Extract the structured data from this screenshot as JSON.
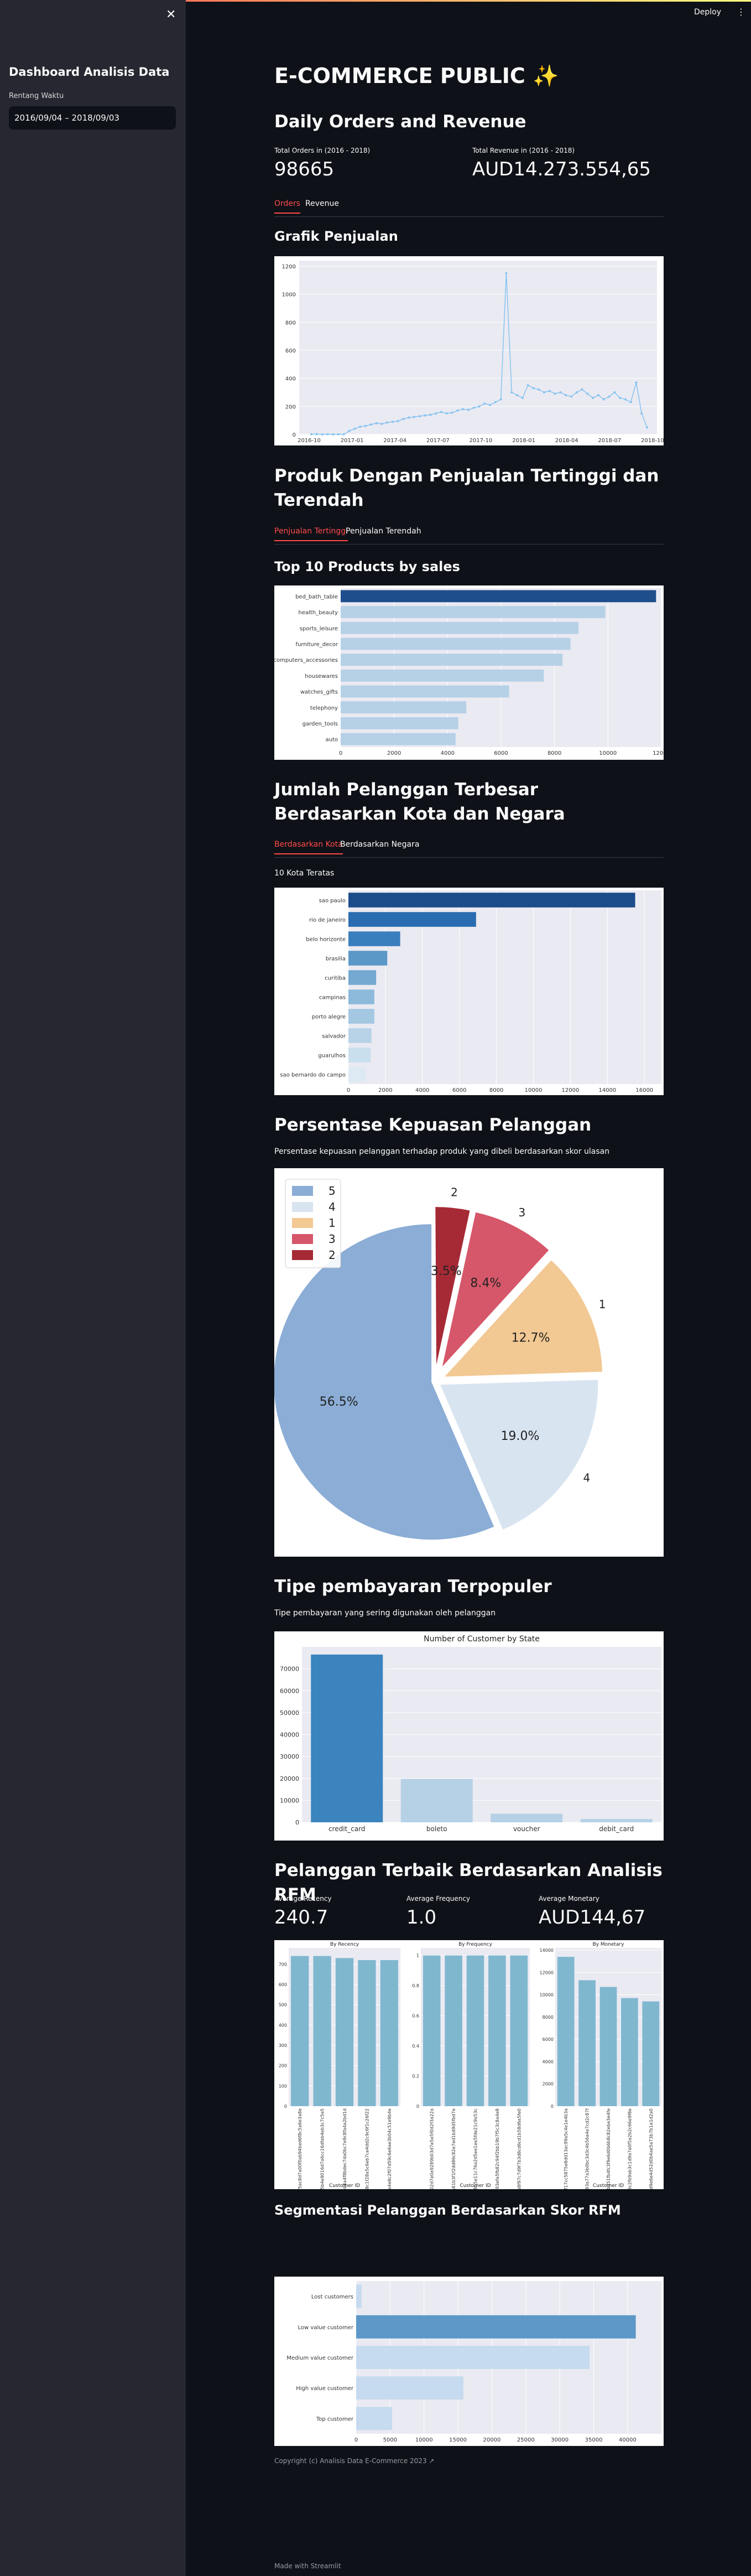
{
  "app": {
    "deploy_label": "Deploy",
    "more_icon": "vertical-dots-icon",
    "close_icon": "close-icon",
    "made_with": "Made with Streamlit"
  },
  "sidebar": {
    "title": "Dashboard Analisis Data",
    "date_label": "Rentang Waktu",
    "date_value": "2016/09/04 – 2018/09/03"
  },
  "header": {
    "title": "E-COMMERCE PUBLIC ✨"
  },
  "orders": {
    "title": "Daily Orders and Revenue",
    "total_orders_label": "Total Orders in (2016 - 2018)",
    "total_orders_value": "98665",
    "total_revenue_label": "Total Revenue in (2016 - 2018)",
    "total_revenue_value": "AUD14.273.554,65",
    "tabs": [
      "Orders",
      "Revenue"
    ],
    "chart_title": "Grafik Penjualan"
  },
  "products": {
    "title": "Produk Dengan Penjualan Tertinggi dan Terendah",
    "tabs": [
      "Penjualan Tertinggi",
      "Penjualan Terendah"
    ],
    "subtitle": "Top 10 Products by sales"
  },
  "customers": {
    "title": "Jumlah Pelanggan Terbesar Berdasarkan Kota dan Negara",
    "tabs": [
      "Berdasarkan Kota",
      "Berdasarkan Negara"
    ],
    "subtitle": "10 Kota Teratas"
  },
  "satisfaction": {
    "title": "Persentase Kepuasan Pelanggan",
    "caption": "Persentase kepuasan pelanggan terhadap produk yang dibeli berdasarkan skor ulasan"
  },
  "payment": {
    "title": "Tipe pembayaran Terpopuler",
    "caption": "Tipe pembayaran yang sering digunakan oleh pelanggan"
  },
  "rfm": {
    "title": "Pelanggan Terbaik Berdasarkan Analisis RFM",
    "recency_label": "Average Recency",
    "recency_value": "240.7",
    "frequency_label": "Average Frequency",
    "frequency_value": "1.0",
    "monetary_label": "Average Monetary",
    "monetary_value": "AUD144,67"
  },
  "segment": {
    "title": "Segmentasi Pelanggan Berdasarkan Skor RFM"
  },
  "footer": {
    "copyright": "Copyright (c) Analisis Data E-Commerce 2023 ↗"
  },
  "chart_data": [
    {
      "type": "line",
      "title": "",
      "xlabel": "",
      "ylabel": "",
      "x_ticks": [
        "2016-10",
        "2017-01",
        "2017-04",
        "2017-07",
        "2017-10",
        "2018-01",
        "2018-04",
        "2018-07",
        "2018-10"
      ],
      "y_ticks": [
        0,
        200,
        400,
        600,
        800,
        1000,
        1200
      ],
      "ylim": [
        0,
        1200
      ],
      "series": [
        {
          "values": [
            1,
            2,
            0,
            1,
            0,
            1,
            0,
            25,
            40,
            55,
            60,
            70,
            80,
            75,
            85,
            90,
            95,
            110,
            120,
            125,
            130,
            135,
            140,
            150,
            160,
            150,
            155,
            170,
            180,
            175,
            190,
            200,
            220,
            210,
            230,
            250,
            1150,
            300,
            280,
            260,
            350,
            330,
            320,
            300,
            310,
            290,
            300,
            280,
            270,
            300,
            320,
            290,
            260,
            280,
            250,
            270,
            300,
            260,
            250,
            230,
            370,
            150,
            50
          ]
        }
      ],
      "color": "#87c4f0"
    },
    {
      "type": "bar",
      "orientation": "horizontal",
      "title": "",
      "categories": [
        "bed_bath_table",
        "health_beauty",
        "sports_leisure",
        "furniture_decor",
        "computers_accessories",
        "housewares",
        "watches_gifts",
        "telephony",
        "garden_tools",
        "auto"
      ],
      "values": [
        11800,
        9900,
        8900,
        8600,
        8300,
        7600,
        6300,
        4700,
        4400,
        4300
      ],
      "xlim": [
        0,
        12000
      ],
      "x_ticks": [
        0,
        2000,
        4000,
        6000,
        8000,
        10000,
        12000
      ],
      "colors": [
        "#1f4e8c",
        "#b6d1e6",
        "#b6d1e6",
        "#b6d1e6",
        "#b6d1e6",
        "#b6d1e6",
        "#b6d1e6",
        "#b6d1e6",
        "#b6d1e6",
        "#b6d1e6"
      ]
    },
    {
      "type": "bar",
      "orientation": "horizontal",
      "title": "",
      "categories": [
        "sao paulo",
        "rio de janeiro",
        "belo horizonte",
        "brasilia",
        "curitiba",
        "campinas",
        "porto alegre",
        "salvador",
        "guarulhos",
        "sao bernardo do campo"
      ],
      "values": [
        15500,
        6900,
        2800,
        2100,
        1500,
        1400,
        1400,
        1250,
        1200,
        950
      ],
      "xlim": [
        0,
        16500
      ],
      "x_ticks": [
        0,
        2000,
        4000,
        6000,
        8000,
        10000,
        12000,
        14000,
        16000
      ],
      "colors": [
        "#1d4c8a",
        "#2a6cb0",
        "#3a7fbd",
        "#5b98c8",
        "#75a9d2",
        "#8db9db",
        "#a4c7e2",
        "#b8d3e8",
        "#cadfee",
        "#dde9f3"
      ]
    },
    {
      "type": "pie",
      "title": "",
      "labels": [
        "5",
        "4",
        "1",
        "3",
        "2"
      ],
      "values": [
        56.5,
        19.0,
        12.7,
        8.4,
        3.5
      ],
      "pct_labels": [
        "56.5%",
        "19.0%",
        "12.7%",
        "8.4%",
        "3.5%"
      ],
      "colors": [
        "#8badd6",
        "#d8e4f0",
        "#f2c893",
        "#d6576a",
        "#a62a36"
      ],
      "legend": "top-left"
    },
    {
      "type": "bar",
      "title": "Number of Customer by State",
      "categories": [
        "credit_card",
        "boleto",
        "voucher",
        "debit_card"
      ],
      "values": [
        76500,
        19800,
        3900,
        1500
      ],
      "ylim": [
        0,
        80000
      ],
      "y_ticks": [
        0,
        10000,
        20000,
        30000,
        40000,
        50000,
        60000,
        70000
      ],
      "colors": [
        "#3b84bd",
        "#b6d1e6",
        "#b6d1e6",
        "#b6d1e6"
      ]
    },
    {
      "type": "bar",
      "title": "By Recency",
      "xlabel": "Customer ID",
      "categories": [
        "0f5ac8d7a00f0ab94bed6f8c5a6e3a8e",
        "d55b4e9016d7a6cc16dfab4eb3c7c5e5",
        "2eb4a4f8bdec7da0bc7e9c8fa4a2bd1d",
        "18c1f28a5c6eb7ce4dd2c9c6f1c26f22",
        "7be4e8c2f07d59c6e6ae3b04c51e9b4e"
      ],
      "values": [
        740,
        740,
        730,
        720,
        720
      ],
      "ylim": [
        0,
        780
      ],
      "y_ticks": [
        0,
        100,
        200,
        300,
        400,
        500,
        600,
        700
      ],
      "color": "#7fb7cf"
    },
    {
      "type": "bar",
      "title": "By Frequency",
      "xlabel": "Customer ID",
      "categories": [
        "0002d7e0a9289b03d7e5e5f0d2f3a22a",
        "ea81b3f1f2dd86c82e7ed1bd9d5fbd7e",
        "ae8b5e11c76a2d5ee1ee5fde21c9a53c",
        "d93efa5fb82c94f2bb19b7f5c3c8a4e8",
        "aa8f97c7d9f7b3d8cd6cd1b58d6a5fe0"
      ],
      "values": [
        1,
        1,
        1,
        1,
        1
      ],
      "ylim": [
        0,
        1.05
      ],
      "y_ticks": [
        0,
        0.2,
        0.4,
        0.6,
        0.8,
        1.0
      ],
      "color": "#7fb7cf"
    },
    {
      "type": "bar",
      "title": "By Monetary",
      "xlabel": "Customer ID",
      "categories": [
        "16f17cc5875e8dd13ac99a5c4e1e4b3a",
        "4b93a77a3b0bc3d3c4b56a4e7cd2c87f",
        "dbd51fb4fc3f9e6d0b6b8c82ebe3e4fe",
        "63c2fb9ab3c1d9a7e0f5a2b2c66e9f8e",
        "cb8d9e6e4d52d0b4ae5a73b7b1e1d2a0"
      ],
      "values": [
        13400,
        11300,
        10700,
        9700,
        9400
      ],
      "ylim": [
        0,
        14200
      ],
      "y_ticks": [
        0,
        2000,
        4000,
        6000,
        8000,
        10000,
        12000,
        14000
      ],
      "color": "#7fb7cf"
    },
    {
      "type": "bar",
      "orientation": "horizontal",
      "title": "",
      "categories": [
        "Lost customers",
        "Low value customer",
        "Medium value customer",
        "High value customer",
        "Top customer"
      ],
      "values": [
        800,
        41200,
        34400,
        15800,
        5300
      ],
      "xlim": [
        0,
        44000
      ],
      "x_ticks": [
        0,
        5000,
        10000,
        15000,
        20000,
        25000,
        30000,
        35000,
        40000
      ],
      "colors": [
        "#c6dbef",
        "#5d98c8",
        "#c6dbef",
        "#c6dbef",
        "#c6dbef"
      ]
    }
  ]
}
